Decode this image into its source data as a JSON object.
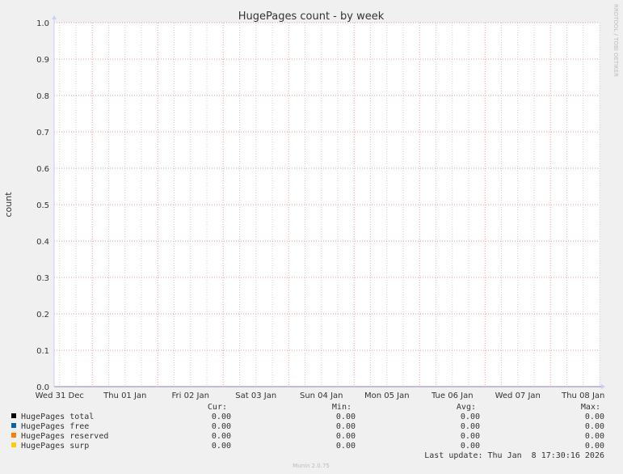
{
  "chart_data": {
    "type": "line",
    "title": "HugePages count - by week",
    "ylabel": "count",
    "xlabel": "",
    "ylim": [
      0,
      1.0
    ],
    "yticks": [
      "0.0",
      "0.1",
      "0.2",
      "0.3",
      "0.4",
      "0.5",
      "0.6",
      "0.7",
      "0.8",
      "0.9",
      "1.0"
    ],
    "xlim": [
      "2025-12-31 10:00",
      "2026-01-08 18:00"
    ],
    "xticks": [
      {
        "label": "Wed 31 Dec",
        "at": "2025-12-31 12:00"
      },
      {
        "label": "Thu 01 Jan",
        "at": "2026-01-01 12:00"
      },
      {
        "label": "Fri 02 Jan",
        "at": "2026-01-02 12:00"
      },
      {
        "label": "Sat 03 Jan",
        "at": "2026-01-03 12:00"
      },
      {
        "label": "Sun 04 Jan",
        "at": "2026-01-04 12:00"
      },
      {
        "label": "Mon 05 Jan",
        "at": "2026-01-05 12:00"
      },
      {
        "label": "Tue 06 Jan",
        "at": "2026-01-06 12:00"
      },
      {
        "label": "Wed 07 Jan",
        "at": "2026-01-07 12:00"
      },
      {
        "label": "Thu 08 Jan",
        "at": "2026-01-08 12:00"
      }
    ],
    "grid": true,
    "series": [
      {
        "name": "HugePages total",
        "color": "#000000",
        "x": [
          "2025-12-31 10:00",
          "2026-01-08 18:00"
        ],
        "values": [
          0,
          0
        ],
        "cur": "0.00",
        "min": "0.00",
        "avg": "0.00",
        "max": "0.00"
      },
      {
        "name": "HugePages free",
        "color": "#0066b3",
        "x": [
          "2025-12-31 10:00",
          "2026-01-08 18:00"
        ],
        "values": [
          0,
          0
        ],
        "cur": "0.00",
        "min": "0.00",
        "avg": "0.00",
        "max": "0.00"
      },
      {
        "name": "HugePages reserved",
        "color": "#ff8000",
        "x": [
          "2025-12-31 10:00",
          "2026-01-08 18:00"
        ],
        "values": [
          0,
          0
        ],
        "cur": "0.00",
        "min": "0.00",
        "avg": "0.00",
        "max": "0.00"
      },
      {
        "name": "HugePages surp",
        "color": "#ffcc00",
        "x": [
          "2025-12-31 10:00",
          "2026-01-08 18:00"
        ],
        "values": [
          0,
          0
        ],
        "cur": "0.00",
        "min": "0.00",
        "avg": "0.00",
        "max": "0.00"
      }
    ],
    "legend_headers": {
      "cur": "Cur:",
      "min": "Min:",
      "avg": "Avg:",
      "max": "Max:"
    },
    "legend": "bottom"
  },
  "last_update": "Last update: Thu Jan  8 17:30:16 2026",
  "watermark": "RRDTOOL / TOBI OETIKER",
  "footer": "Munin 2.0.75"
}
